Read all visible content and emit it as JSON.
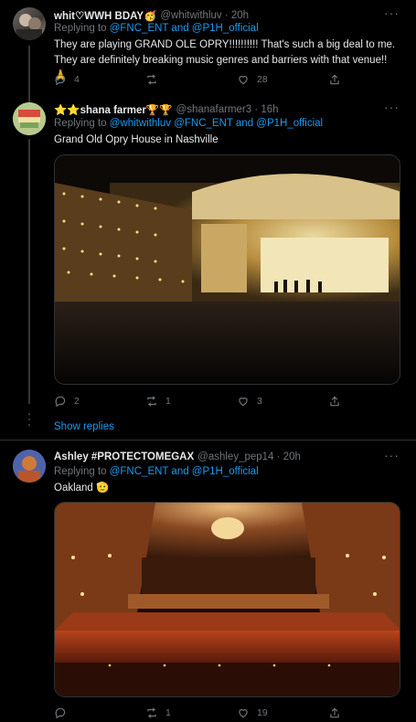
{
  "tweets": [
    {
      "name": "whit♡WWH BDAY🥳",
      "handle": "@whitwithluv · 20h",
      "text": "They are playing GRAND OLE OPRY!!!!!!!!!! That's such a big deal to me. They are definitely breaking music genres and barriers with that venue!!🙏",
      "replies": "4",
      "retweets": "",
      "likes": "28",
      "more": "···"
    },
    {
      "name": "⭐⭐shana farmer🏆🏆",
      "handle": "@shanafarmer3 · 16h",
      "replying_prefix": "Replying to ",
      "replying_links": "@whitwithluv @FNC_ENT and @P1H_official",
      "text": "Grand Old Opry House in Nashville",
      "replies": "2",
      "retweets": "1",
      "likes": "3",
      "more": "···"
    },
    {
      "name": "Ashley #PROTECTOMEGAX",
      "handle": "@ashley_pep14 · 20h",
      "replying_prefix": "Replying to ",
      "replying_links": "@FNC_ENT and @P1H_official",
      "text": "Oakland 🫡",
      "replies": "",
      "retweets": "1",
      "likes": "19",
      "more": "···"
    }
  ],
  "top": {
    "replying_prefix": "Replying to ",
    "replying_links": "@FNC_ENT and @P1H_official"
  },
  "show_replies": "Show replies"
}
